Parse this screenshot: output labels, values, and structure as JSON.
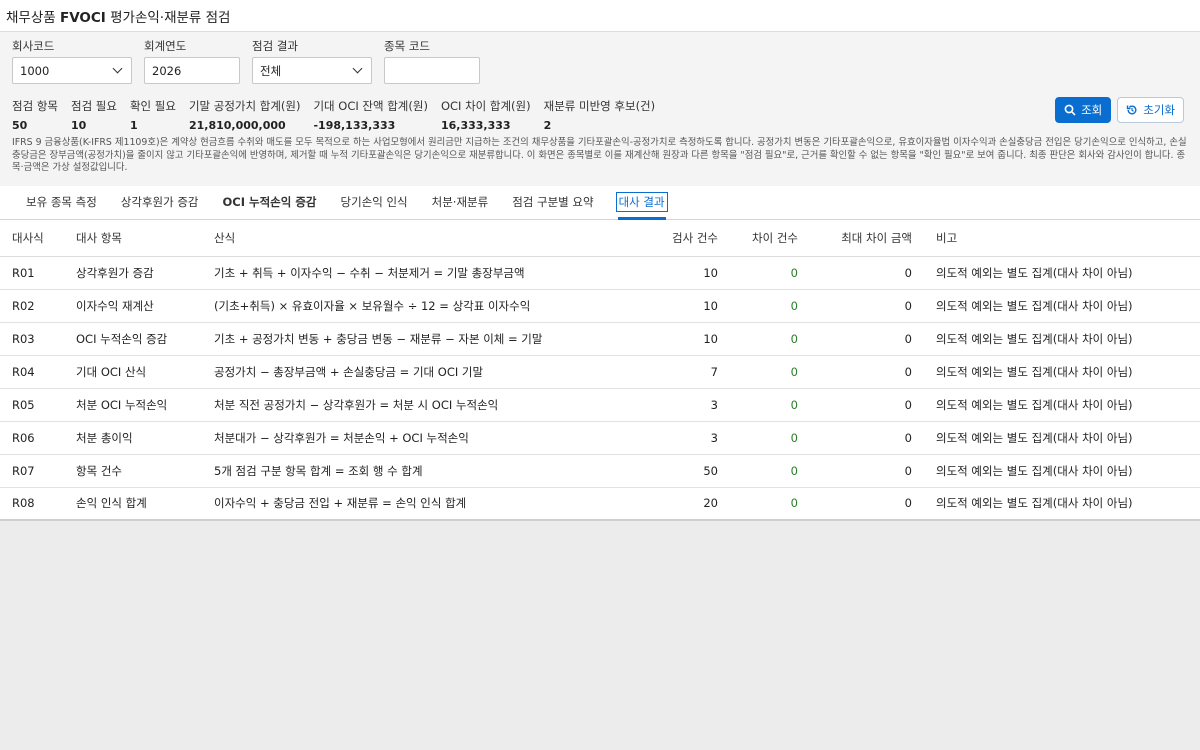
{
  "title": {
    "prefix": "채무상품 ",
    "bold": "FVOCI",
    "suffix": " 평가손익·재분류 점검"
  },
  "filters": {
    "company": {
      "label": "회사코드",
      "value": "1000"
    },
    "year": {
      "label": "회계연도",
      "value": "2026"
    },
    "result": {
      "label": "점검 결과",
      "value": "전체"
    },
    "item": {
      "label": "종목 코드",
      "value": ""
    }
  },
  "actions": {
    "search": "조회",
    "reset": "초기화"
  },
  "stats": [
    {
      "k": "점검 항목",
      "v": "50"
    },
    {
      "k": "점검 필요",
      "v": "10"
    },
    {
      "k": "확인 필요",
      "v": "1"
    },
    {
      "k": "기말 공정가치 합계(원)",
      "v": "21,810,000,000"
    },
    {
      "k": "기대 OCI 잔액 합계(원)",
      "v": "-198,133,333"
    },
    {
      "k": "OCI 차이 합계(원)",
      "v": "16,333,333"
    },
    {
      "k": "재분류 미반영 후보(건)",
      "v": "2"
    }
  ],
  "note": "IFRS 9 금융상품(K-IFRS 제1109호)은 계약상 현금흐름 수취와 매도를 모두 목적으로 하는 사업모형에서 원리금만 지급하는 조건의 채무상품을 기타포괄손익-공정가치로 측정하도록 합니다. 공정가치 변동은 기타포괄손익으로, 유효이자율법 이자수익과 손실충당금 전입은 당기손익으로 인식하고, 손실충당금은 장부금액(공정가치)을 줄이지 않고 기타포괄손익에 반영하며, 제거할 때 누적 기타포괄손익은 당기손익으로 재분류합니다. 이 화면은 종목별로 이를 재계산해 원장과 다른 항목을 \"점검 필요\"로, 근거를 확인할 수 없는 항목을 \"확인 필요\"로 보여 줍니다. 최종 판단은 회사와 감사인이 합니다. 종목·금액은 가상 설정값입니다.",
  "tabs": [
    {
      "label": "보유 종목 측정",
      "bold": false,
      "active": false
    },
    {
      "label": "상각후원가 증감",
      "bold": false,
      "active": false
    },
    {
      "label": "OCI 누적손익 증감",
      "bold": true,
      "active": false
    },
    {
      "label": "당기손익 인식",
      "bold": false,
      "active": false
    },
    {
      "label": "처분·재분류",
      "bold": false,
      "active": false
    },
    {
      "label": "점검 구분별 요약",
      "bold": false,
      "active": false
    },
    {
      "label": "대사 결과",
      "bold": false,
      "active": true
    }
  ],
  "table": {
    "headers": [
      "대사식",
      "대사 항목",
      "산식",
      "검사 건수",
      "차이 건수",
      "최대 차이 금액",
      "비고"
    ],
    "rows": [
      [
        "R01",
        "상각후원가 증감",
        "기초 + 취득 + 이자수익 − 수취 − 처분제거 = 기말 총장부금액",
        "10",
        "0",
        "0",
        "의도적 예외는 별도 집계(대사 차이 아님)"
      ],
      [
        "R02",
        "이자수익 재계산",
        "(기초+취득) × 유효이자율 × 보유월수 ÷ 12 = 상각표 이자수익",
        "10",
        "0",
        "0",
        "의도적 예외는 별도 집계(대사 차이 아님)"
      ],
      [
        "R03",
        "OCI 누적손익 증감",
        "기초 + 공정가치 변동 + 충당금 변동 − 재분류 − 자본 이체 = 기말",
        "10",
        "0",
        "0",
        "의도적 예외는 별도 집계(대사 차이 아님)"
      ],
      [
        "R04",
        "기대 OCI 산식",
        "공정가치 − 총장부금액 + 손실충당금 = 기대 OCI 기말",
        "7",
        "0",
        "0",
        "의도적 예외는 별도 집계(대사 차이 아님)"
      ],
      [
        "R05",
        "처분 OCI 누적손익",
        "처분 직전 공정가치 − 상각후원가 = 처분 시 OCI 누적손익",
        "3",
        "0",
        "0",
        "의도적 예외는 별도 집계(대사 차이 아님)"
      ],
      [
        "R06",
        "처분 총이익",
        "처분대가 − 상각후원가 = 처분손익 + OCI 누적손익",
        "3",
        "0",
        "0",
        "의도적 예외는 별도 집계(대사 차이 아님)"
      ],
      [
        "R07",
        "항목 건수",
        "5개 점검 구분 항목 합계 = 조회 행 수 합계",
        "50",
        "0",
        "0",
        "의도적 예외는 별도 집계(대사 차이 아님)"
      ],
      [
        "R08",
        "손익 인식 합계",
        "이자수익 + 충당금 전입 + 재분류 = 손익 인식 합계",
        "20",
        "0",
        "0",
        "의도적 예외는 별도 집계(대사 차이 아님)"
      ]
    ]
  }
}
